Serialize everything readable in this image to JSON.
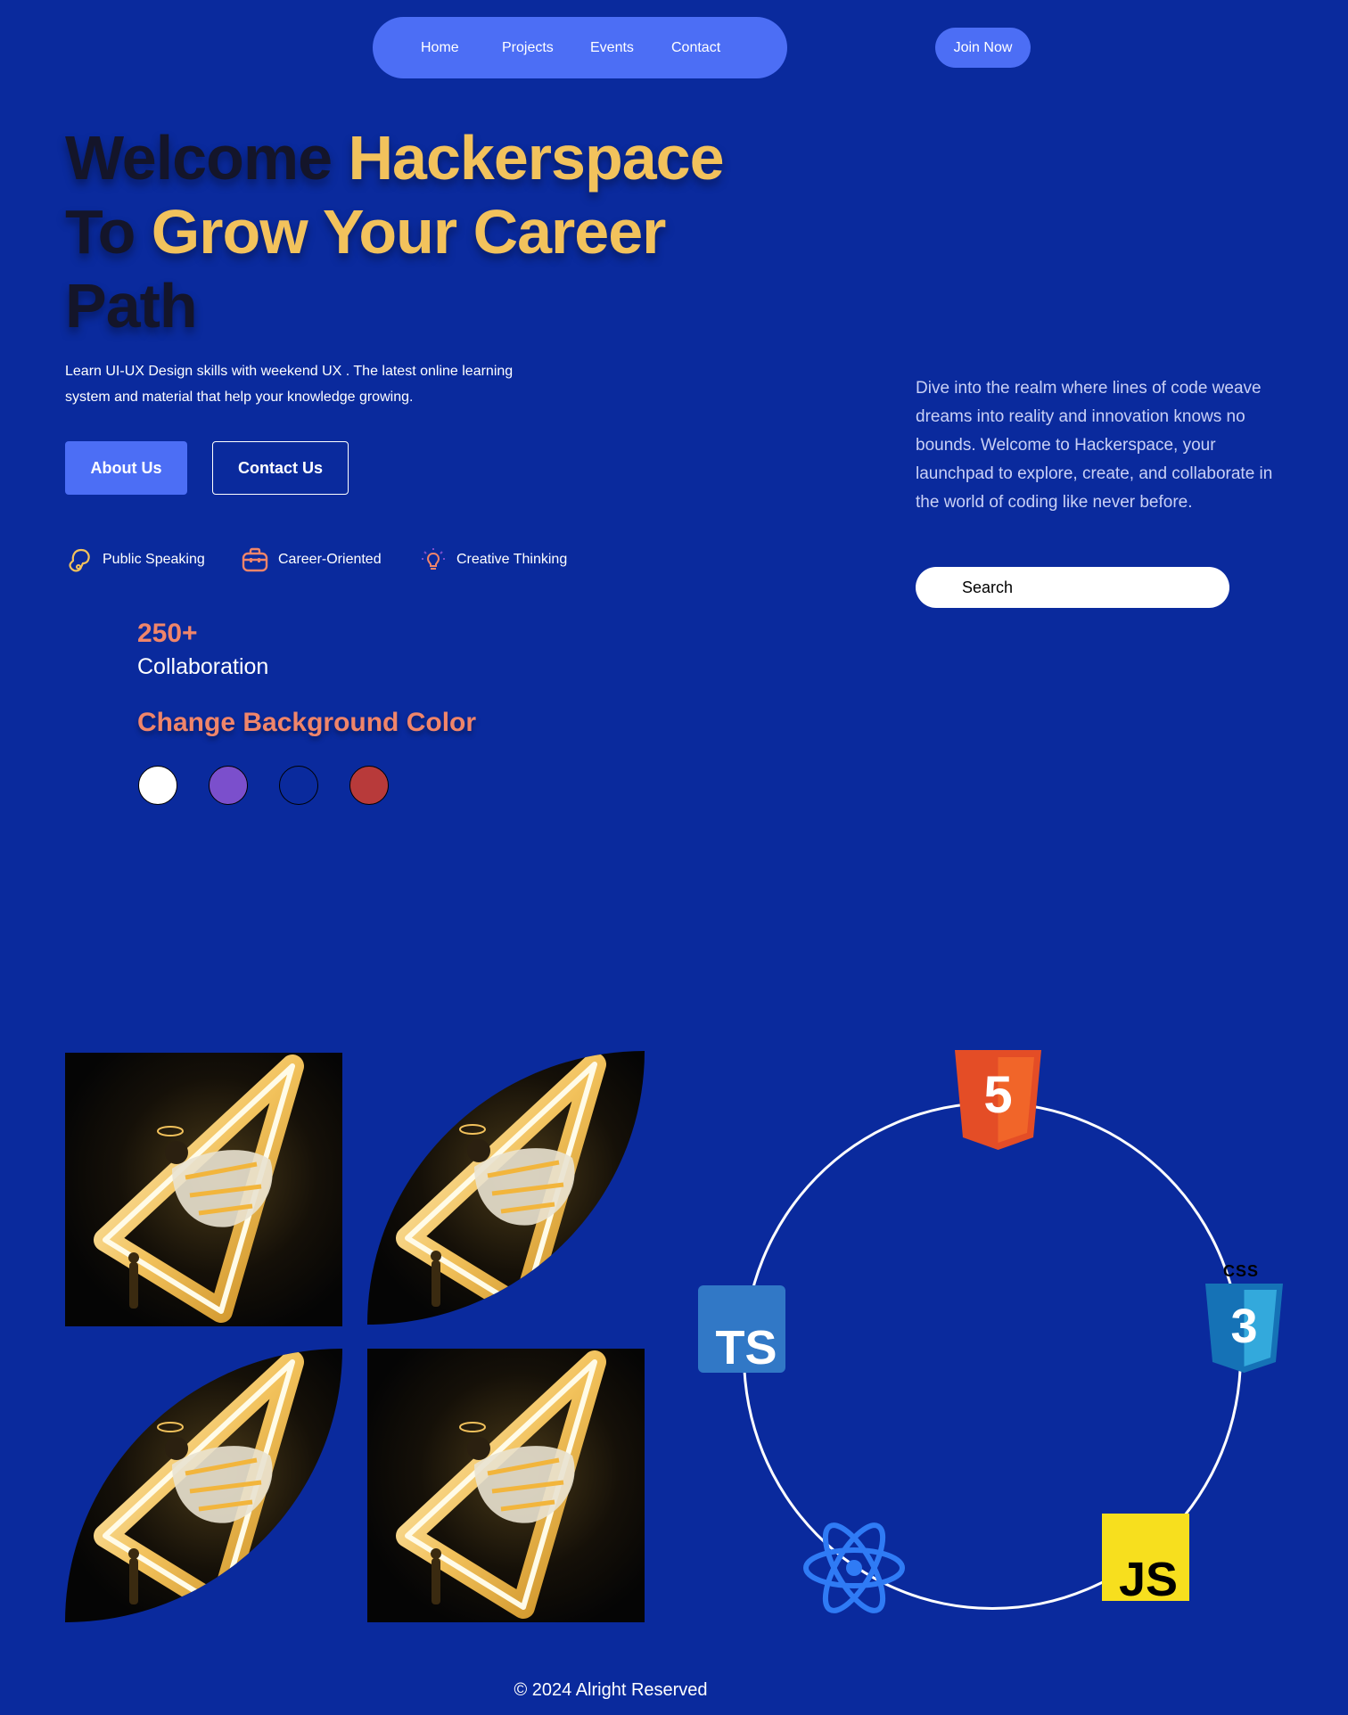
{
  "nav": {
    "items": [
      {
        "label": "Home"
      },
      {
        "label": "Projects"
      },
      {
        "label": "Events"
      },
      {
        "label": "Contact"
      }
    ],
    "join_label": "Join Now"
  },
  "hero": {
    "title_line1_dark": "Welcome ",
    "title_line1_accent": "Hackerspace",
    "title_line2_dark": "To ",
    "title_line2_accent": "Grow Your Career",
    "title_line3_dark": "Path",
    "description": "Learn UI-UX Design skills with weekend UX . The latest online learning system and material that help your knowledge growing.",
    "about_label": "About Us",
    "contact_label": "Contact Us"
  },
  "features": [
    {
      "icon": "speaking-head-icon",
      "label": "Public Speaking"
    },
    {
      "icon": "briefcase-icon",
      "label": "Career-Oriented"
    },
    {
      "icon": "lightbulb-icon",
      "label": "Creative Thinking"
    }
  ],
  "stats": {
    "value": "250+",
    "label": "Collaboration"
  },
  "background_picker": {
    "title": "Change Background Color",
    "colors": [
      "#ffffff",
      "#7b4fcc",
      "#0a2a9d",
      "#b83a3a"
    ]
  },
  "side": {
    "description": "Dive into the realm where lines of code weave dreams into reality and innovation knows no bounds. Welcome to Hackerspace, your launchpad to explore, create, and collaborate in the world of coding like never before.",
    "search_placeholder": "Search"
  },
  "tech_logos": {
    "html": {
      "name": "html5-logo",
      "glyph": "5"
    },
    "css": {
      "name": "css3-logo",
      "glyph": "3",
      "caption": "CSS"
    },
    "ts": {
      "name": "typescript-logo",
      "text": "TS"
    },
    "js": {
      "name": "javascript-logo",
      "text": "JS"
    },
    "react": {
      "name": "react-logo"
    }
  },
  "footer": {
    "text": "© 2024 Alright Reserved"
  },
  "colors": {
    "background": "#0a2a9d",
    "accent_blue": "#4c6ef5",
    "accent_yellow": "#f2c25c",
    "accent_coral": "#f0856a"
  }
}
